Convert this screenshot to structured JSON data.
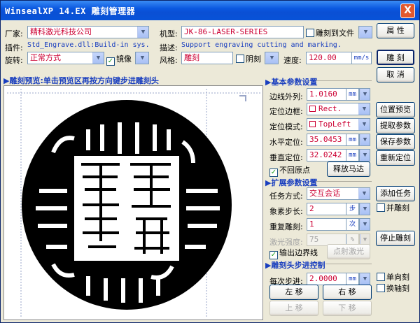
{
  "window": {
    "title": "WinsealXP 14.EX 雕刻管理器",
    "close": "X"
  },
  "row1": {
    "vendor_label": "厂家:",
    "vendor_value": "精科激光科技公司",
    "model_label": "机型:",
    "model_value": "JK-86-LASER-SERIES",
    "engrave_to_file_label": "雕刻到文件",
    "engrave_to_file_checked": false,
    "properties_button": "属 性"
  },
  "row2": {
    "plugin_label": "插件:",
    "plugin_value": "Std_Engrave.dll:Build-in sys.",
    "desc_label": "描述:",
    "desc_value": "Support engraving cutting and marking."
  },
  "row3": {
    "rotate_label": "旋转:",
    "rotate_value": "正常方式",
    "mirror_label": "镜像",
    "mirror_checked": true,
    "style_label": "风格:",
    "style_value": "雕刻",
    "relief_label": "阴刻",
    "relief_checked": false,
    "speed_label": "速度:",
    "speed_value": "120.00",
    "speed_unit": "mm/s",
    "engrave_button": "雕 刻"
  },
  "cancel_button": "取 消",
  "preview": {
    "header": "▶雕刻预览:单击预览区再按方向键步进雕刻头"
  },
  "basic": {
    "header": "▶基本参数设置",
    "border_label": "边线外列:",
    "border_value": "1.0160",
    "border_unit": "mm",
    "frame_label": "定位边框:",
    "frame_value": "Rect.",
    "mode_label": "定位模式:",
    "mode_value": "TopLeft",
    "hpos_label": "水平定位:",
    "hpos_value": "35.0453",
    "hpos_unit": "mm",
    "vpos_label": "垂直定位:",
    "vpos_value": "32.0242",
    "vpos_unit": "mm",
    "no_return_label": "不回原点",
    "no_return_checked": true,
    "release_button": "释放马达"
  },
  "side_buttons": {
    "preview_pos": "位置预览",
    "extract_params": "提取参数",
    "save_params": "保存参数",
    "reposition": "重新定位"
  },
  "ext": {
    "header": "▶扩展参数设置",
    "task_label": "任务方式:",
    "task_value": "交互会话",
    "pixel_label": "象素步长:",
    "pixel_value": "2",
    "pixel_unit": "步",
    "repeat_label": "重复雕刻:",
    "repeat_value": "1",
    "repeat_unit": "次",
    "laser_label": "激光强度:",
    "laser_value": "75",
    "laser_unit": "%",
    "output_border_label": "输出边界线",
    "output_border_checked": true,
    "dot_laser_button": "点射激光",
    "add_task_button": "添加任务",
    "parallel_label": "并雕刻",
    "parallel_checked": false,
    "stop_button": "停止雕刻"
  },
  "step": {
    "header": "▶雕刻头步进控制",
    "step_label": "每次步进:",
    "step_value": "2.0000",
    "step_unit": "mm",
    "single_dir_label": "单向刻",
    "single_dir_checked": false,
    "swap_axis_label": "换轴刻",
    "swap_axis_checked": false,
    "left_button": "左 移",
    "right_button": "右 移",
    "up_button": "上 移",
    "down_button": "下 移"
  }
}
